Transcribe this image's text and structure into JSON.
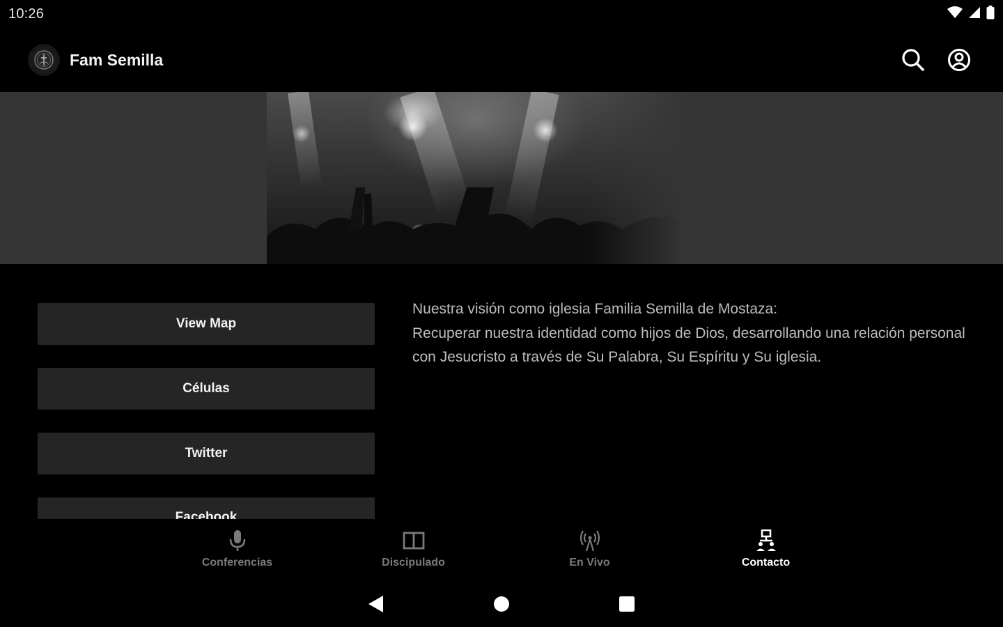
{
  "status_bar": {
    "time": "10:26",
    "icons": [
      "wifi-icon",
      "signal-icon",
      "battery-icon"
    ]
  },
  "app_bar": {
    "title": "Fam Semilla",
    "logo_icon": "church-logo-icon",
    "actions": [
      {
        "name": "search-icon"
      },
      {
        "name": "account-icon"
      }
    ]
  },
  "banner": {
    "image_icon": "worship-concert-photo"
  },
  "buttons": [
    {
      "label": "View Map"
    },
    {
      "label": "Células"
    },
    {
      "label": "Twitter"
    },
    {
      "label": "Facebook"
    }
  ],
  "vision": {
    "heading": "Nuestra visión como iglesia Familia Semilla de Mostaza:",
    "body": "Recuperar nuestra identidad como hijos de Dios, desarrollando una relación personal con Jesucristo a través de Su Palabra, Su Espíritu y Su iglesia."
  },
  "bottom_nav": {
    "items": [
      {
        "label": "Conferencias",
        "icon": "microphone-icon",
        "active": false
      },
      {
        "label": "Discipulado",
        "icon": "book-icon",
        "active": false
      },
      {
        "label": "En Vivo",
        "icon": "broadcast-icon",
        "active": false
      },
      {
        "label": "Contacto",
        "icon": "contact-icon",
        "active": true
      }
    ]
  },
  "system_nav": {
    "items": [
      "back-icon",
      "home-icon",
      "recents-icon"
    ]
  },
  "colors": {
    "background": "#000000",
    "banner_bg": "#353535",
    "button_bg": "#252525",
    "text_primary": "#f2f2f2",
    "text_secondary": "#bdbdbd",
    "nav_inactive": "#7a7a7a"
  }
}
